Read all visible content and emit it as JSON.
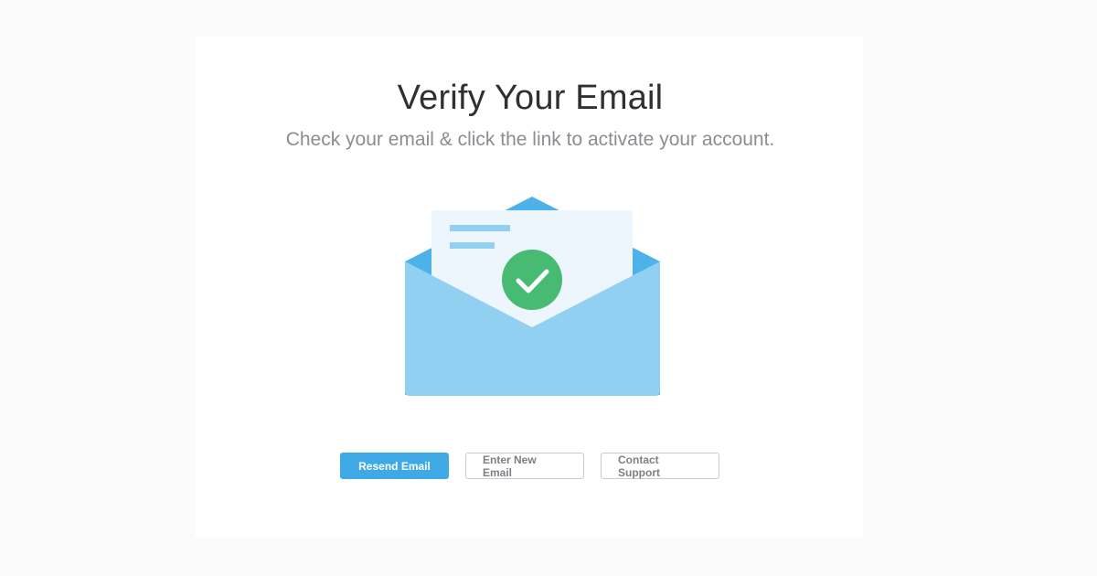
{
  "page": {
    "title": "Verify Your Email",
    "subtitle": "Check your email & click the link to activate your account."
  },
  "illustration": {
    "icon": "email-verified-envelope",
    "colors": {
      "envelope_back": "#4eb2ea",
      "envelope_front": "#92d0f2",
      "letter": "#edf6fd",
      "letter_lines": "#92d0f2",
      "check_circle": "#47bb72",
      "check_mark": "#ffffff"
    }
  },
  "actions": {
    "resend_label": "Resend Email",
    "new_email_label": "Enter New Email",
    "support_label": "Contact Support"
  },
  "colors": {
    "primary": "#3fa9e6",
    "background": "#fbfbfb"
  }
}
